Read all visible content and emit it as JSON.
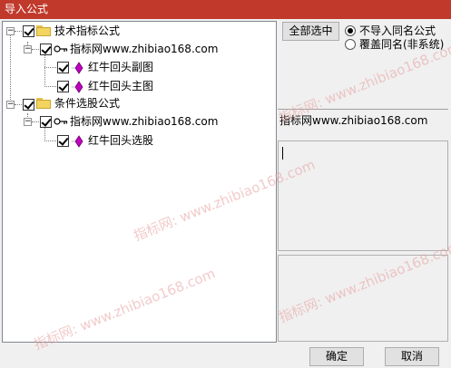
{
  "window": {
    "title": "导入公式"
  },
  "tree": {
    "groups": [
      {
        "label": "技术指标公式",
        "source": {
          "label": "指标网www.zhibiao168.com",
          "items": [
            {
              "label": "红牛回头副图"
            },
            {
              "label": "红牛回头主图"
            }
          ]
        }
      },
      {
        "label": "条件选股公式",
        "source": {
          "label": "指标网www.zhibiao168.com",
          "items": [
            {
              "label": "红牛回头选股"
            }
          ]
        }
      }
    ]
  },
  "options": {
    "select_all_label": "全部选中",
    "radio_skip_label": "不导入同名公式",
    "radio_overwrite_label": "覆盖同名(非系统)",
    "selected": "skip"
  },
  "info": {
    "source_name": "指标网www.zhibiao168.com"
  },
  "footer": {
    "ok_label": "确定",
    "cancel_label": "取消"
  },
  "watermark": {
    "text": "指标网: www.zhibiao168.com"
  },
  "colors": {
    "titlebar": "#c0392b",
    "gem": "#c000c0",
    "folder": "#f3d45e"
  }
}
